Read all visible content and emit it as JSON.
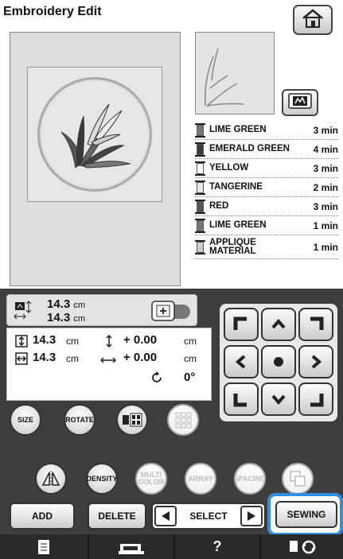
{
  "header": {
    "title": "Embroidery Edit"
  },
  "icons": {
    "home": "home-icon",
    "pattern_view": "pattern-view-icon",
    "frame_size": "frame-size-icon",
    "arrange": "arrange-icon",
    "help": "question-mark"
  },
  "thread_colors": [
    {
      "name": "LIME GREEN",
      "time": "3 min",
      "color": "#777777"
    },
    {
      "name": "EMERALD GREEN",
      "time": "4 min",
      "color": "#3a3a3a"
    },
    {
      "name": "YELLOW",
      "time": "3 min",
      "color": "#ffffff"
    },
    {
      "name": "TANGERINE",
      "time": "2 min",
      "color": "#e8e8e8"
    },
    {
      "name": "RED",
      "time": "3 min",
      "color": "#555555"
    },
    {
      "name": "LIME GREEN",
      "time": "1 min",
      "color": "#777777"
    },
    {
      "name": "APPLIQUE\nMATERIAL",
      "time": "1 min",
      "color": "#cccccc"
    }
  ],
  "size": {
    "width_value": "14.3",
    "height_value": "14.3",
    "unit": "cm"
  },
  "info": {
    "height_value": "14.3",
    "height_unit": "cm",
    "width_value": "14.3",
    "width_unit": "cm",
    "offset_v": "+ 0.00",
    "offset_v_unit": "cm",
    "offset_h": "+ 0.00",
    "offset_h_unit": "cm",
    "angle": "0°"
  },
  "buttons": {
    "size": "SIZE",
    "rotate": "ROTATE",
    "density": "DENSITY",
    "multi_color": "MULTI\nCOLOR",
    "array": "ARRAY",
    "spacing": "SPACING",
    "add": "ADD",
    "delete": "DELETE",
    "select": "SELECT",
    "sewing": "SEWING",
    "help": "?"
  },
  "accent": "#2f8fe0"
}
